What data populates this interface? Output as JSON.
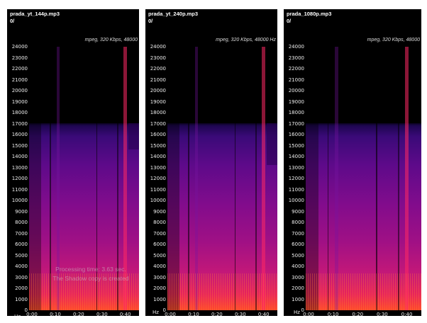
{
  "y_ticks": [
    "24000",
    "23000",
    "22000",
    "21000",
    "20000",
    "19000",
    "18000",
    "17000",
    "16000",
    "15000",
    "14000",
    "13000",
    "12000",
    "11000",
    "10000",
    "9000",
    "8000",
    "7000",
    "6000",
    "5000",
    "4000",
    "3000",
    "2000",
    "1000",
    "0"
  ],
  "x_ticks": [
    "0:00",
    "0:10",
    "0:20",
    "0:30",
    "0:40"
  ],
  "panels": [
    {
      "filename": "prada_yt_144p.mp3",
      "channel": "0/",
      "format": "mpeg, 320 Kbps, 48000",
      "y_unit": "Hz"
    },
    {
      "filename": "prada_yt_240p.mp3",
      "channel": "0/",
      "format": "mpeg, 320 Kbps, 48000 Hz",
      "x_unit": "Hz"
    },
    {
      "filename": "prada_1080p.mp3",
      "channel": "0/",
      "format": "mpeg, 320 Kbps, 48000",
      "x_unit": "Hz"
    }
  ],
  "overlay": {
    "line1": "Processing time: 3.63 sec.",
    "line2": "The Shadow copy is created"
  },
  "colors": {
    "background": "#000000",
    "high": "#ff4a2a",
    "mid": "#a01085",
    "low": "#3a0a78"
  }
}
